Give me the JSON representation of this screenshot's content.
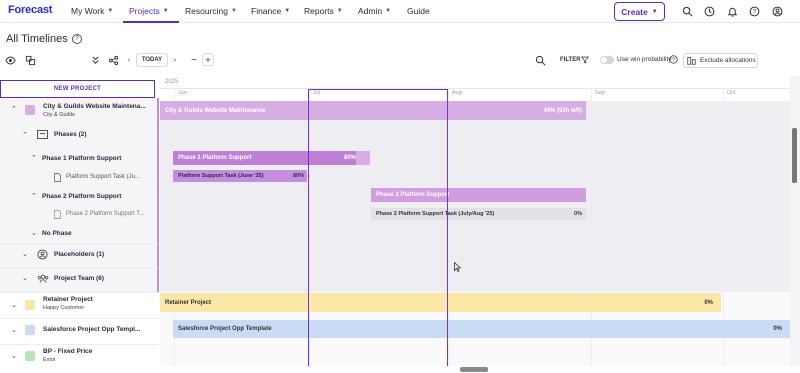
{
  "app": {
    "logo": "Forecast",
    "nav": [
      {
        "label": "My Work"
      },
      {
        "label": "Projects"
      },
      {
        "label": "Resourcing"
      },
      {
        "label": "Finance"
      },
      {
        "label": "Reports"
      },
      {
        "label": "Admin"
      },
      {
        "label": "Guide"
      }
    ],
    "create_label": "Create",
    "accent_color": "#5b2bb5"
  },
  "page": {
    "title": "All Timelines",
    "help_icon": "?"
  },
  "toolbar": {
    "today_label": "TODAY",
    "filter_label": "FILTER",
    "win_probability_label": "Use win probability",
    "exclude_label": "Exclude allocations"
  },
  "left": {
    "new_project_label": "NEW PROJECT",
    "rows": {
      "project1_name": "City & Guilds Website Maintena...",
      "project1_client": "City & Guilds",
      "phases_label": "Phases (2)",
      "phase1_label": "Phase 1 Platform Support",
      "phase1_task": "Platform Support Task  (Ju...",
      "phase2_label": "Phase 2 Platform Support",
      "phase2_task": "Phase 2 Platform Support T...",
      "no_phase_label": "No Phase",
      "placeholders_label": "Placeholders (1)",
      "team_label": "Project Team (6)",
      "project2_name": "Retainer Project",
      "project2_client": "Happy Customer",
      "project3_name": "Salesforce Project Opp Templ...",
      "project4_name": "BP - Fixed Price",
      "project4_client": "Extol"
    }
  },
  "timeline": {
    "year": "2025",
    "months": [
      "Jun",
      "Jul",
      "Aug",
      "Sep",
      "Oct"
    ],
    "bars": {
      "project1_label": "City & Guilds Website Maintenance",
      "project1_pct": "44% (53h left)",
      "phase1_label": "Phase 1 Platform Support",
      "phase1_pct": "80%",
      "task1_label": "Platform Support Task  (June '25)",
      "task1_pct": "80%",
      "phase2_label": "Phase 2 Platform Support",
      "task2_label": "Phase 2 Platform Support Task (July/Aug '25)",
      "task2_pct": "0%",
      "project2_label": "Retainer Project",
      "project2_pct": "0%",
      "project3_label": "Salesforce Project Opp Template",
      "project3_pct": "0%"
    },
    "colors": {
      "project1": "#d7aee3",
      "phase1": "#c07fd6",
      "phase2": "#cf9de0",
      "task": "#e1e1e6",
      "retainer": "#f8e7a6",
      "salesforce": "#c9dcf4",
      "selection": "#7b2fd6"
    }
  }
}
